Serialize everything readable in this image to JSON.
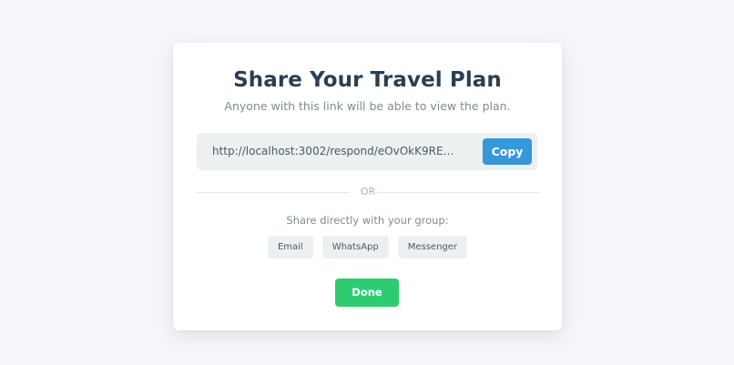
{
  "modal": {
    "title": "Share Your Travel Plan",
    "subtitle": "Anyone with this link will be able to view the plan.",
    "link": {
      "url": "http://localhost:3002/respond/eOvOkK9REUSFdK7AliISVy...",
      "copy_label": "Copy"
    },
    "divider_label": "OR",
    "share_label": "Share directly with your group:",
    "share_options": [
      "Email",
      "WhatsApp",
      "Messenger"
    ],
    "done_label": "Done"
  },
  "colors": {
    "page_background": "#f4f6fa",
    "title": "#2c3e50",
    "copy_button": "#3498db",
    "done_button": "#2ecc71",
    "chip_background": "#ecf0f1"
  }
}
